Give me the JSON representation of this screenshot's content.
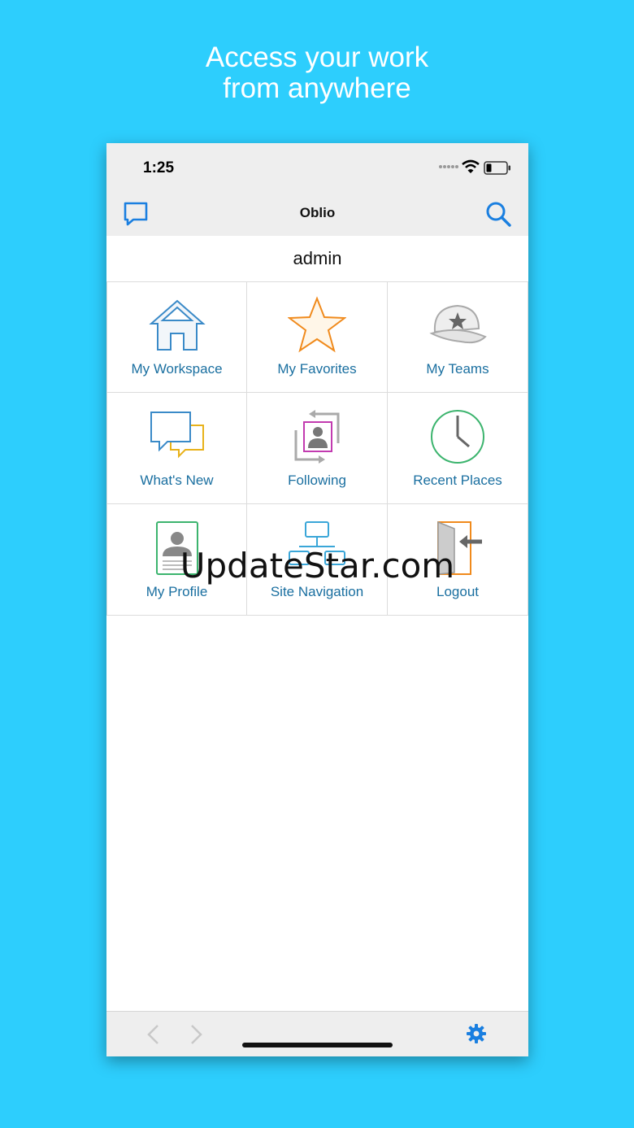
{
  "promo": {
    "line1": "Access your work",
    "line2": "from anywhere"
  },
  "status_bar": {
    "time": "1:25"
  },
  "navbar": {
    "title": "Oblio",
    "left_icon": "chat-bubble-icon",
    "right_icon": "search-icon"
  },
  "user": {
    "name": "admin"
  },
  "tiles": [
    {
      "label": "My Workspace",
      "icon": "house-icon"
    },
    {
      "label": "My Favorites",
      "icon": "star-icon"
    },
    {
      "label": "My Teams",
      "icon": "cap-icon"
    },
    {
      "label": "What's New",
      "icon": "speech-bubbles-icon"
    },
    {
      "label": "Following",
      "icon": "following-icon"
    },
    {
      "label": "Recent Places",
      "icon": "clock-icon"
    },
    {
      "label": "My Profile",
      "icon": "profile-card-icon"
    },
    {
      "label": "Site Navigation",
      "icon": "sitemap-icon"
    },
    {
      "label": "Logout",
      "icon": "door-exit-icon"
    }
  ],
  "watermark": "UpdateStar.com",
  "toolbar": {
    "back_icon": "chevron-left-icon",
    "forward_icon": "chevron-right-icon",
    "settings_icon": "gear-icon"
  },
  "colors": {
    "background": "#2dcefd",
    "accent": "#1a7fe0",
    "tile_label": "#1a6fa0"
  }
}
